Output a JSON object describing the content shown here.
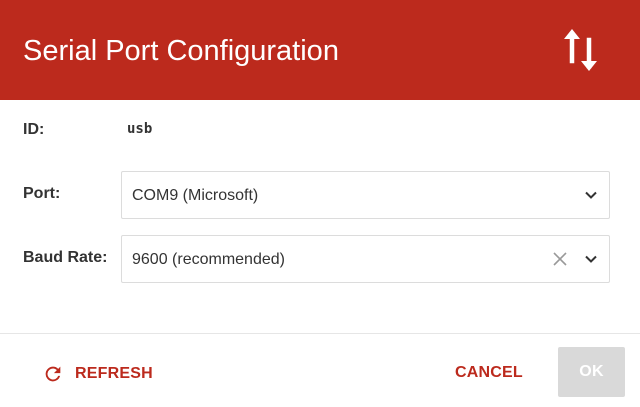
{
  "dialog": {
    "title": "Serial Port Configuration",
    "header_icon": "swap-vertical-icon",
    "header_color": "#bc2a1d"
  },
  "fields": {
    "id": {
      "label": "ID:",
      "value": "usb"
    },
    "port": {
      "label": "Port:",
      "value": "COM9 (Microsoft)",
      "icon": "chevron-down-icon"
    },
    "baud_rate": {
      "label": "Baud Rate:",
      "value": "9600 (recommended)",
      "clear_icon": "close-icon",
      "icon": "chevron-down-icon"
    }
  },
  "actions": {
    "refresh": {
      "label": "REFRESH",
      "icon": "refresh-icon"
    },
    "cancel": {
      "label": "CANCEL"
    },
    "ok": {
      "label": "OK",
      "disabled": true
    }
  },
  "colors": {
    "accent": "#bc2a1d",
    "disabled_button": "#d9d9d9"
  }
}
